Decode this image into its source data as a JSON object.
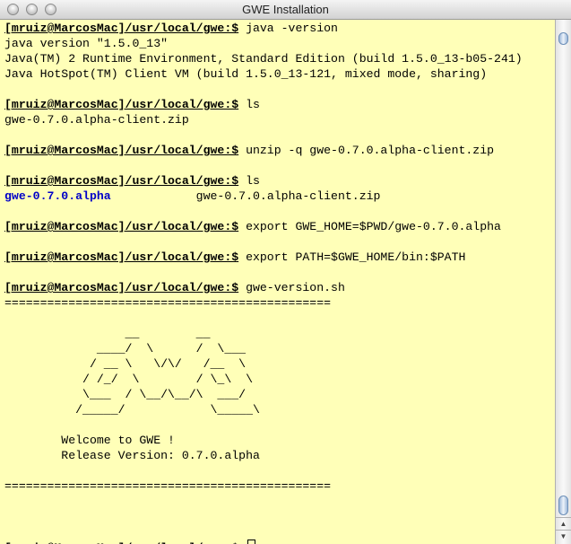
{
  "window": {
    "title": "GWE Installation"
  },
  "prompt": "[mruiz@MarcosMac]/usr/local/gwe:$",
  "terminal": {
    "lines": [
      {
        "prompt": true,
        "text": " java -version"
      },
      {
        "text": "java version \"1.5.0_13\""
      },
      {
        "text": "Java(TM) 2 Runtime Environment, Standard Edition (build 1.5.0_13-b05-241)"
      },
      {
        "text": "Java HotSpot(TM) Client VM (build 1.5.0_13-121, mixed mode, sharing)"
      },
      {
        "text": ""
      },
      {
        "prompt": true,
        "text": " ls"
      },
      {
        "text": "gwe-0.7.0.alpha-client.zip"
      },
      {
        "text": ""
      },
      {
        "prompt": true,
        "text": " unzip -q gwe-0.7.0.alpha-client.zip"
      },
      {
        "text": ""
      },
      {
        "prompt": true,
        "text": " ls"
      },
      {
        "dir": "gwe-0.7.0.alpha",
        "text": "            gwe-0.7.0.alpha-client.zip"
      },
      {
        "text": ""
      },
      {
        "prompt": true,
        "text": " export GWE_HOME=$PWD/gwe-0.7.0.alpha"
      },
      {
        "text": ""
      },
      {
        "prompt": true,
        "text": " export PATH=$GWE_HOME/bin:$PATH"
      },
      {
        "text": ""
      },
      {
        "prompt": true,
        "text": " gwe-version.sh"
      },
      {
        "text": "=============================================="
      },
      {
        "text": ""
      },
      {
        "text": "                 __        __"
      },
      {
        "text": "             ____/  \\      /  \\___"
      },
      {
        "text": "            / __ \\   \\/\\/   /__  \\"
      },
      {
        "text": "           / /_/  \\        / \\_\\  \\"
      },
      {
        "text": "           \\___  / \\__/\\__/\\  ___/"
      },
      {
        "text": "          /_____/            \\_____\\"
      },
      {
        "text": ""
      },
      {
        "text": "        Welcome to GWE !"
      },
      {
        "text": "        Release Version: 0.7.0.alpha"
      },
      {
        "text": ""
      },
      {
        "text": "=============================================="
      },
      {
        "text": ""
      },
      {
        "text": ""
      },
      {
        "text": ""
      },
      {
        "prompt": true,
        "cursor": true,
        "text": " "
      }
    ]
  }
}
